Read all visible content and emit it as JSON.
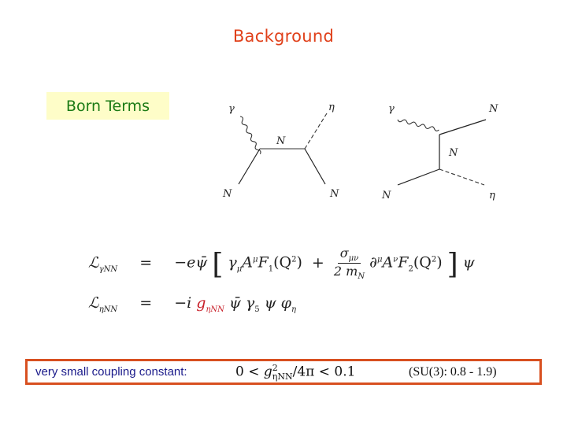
{
  "header": {
    "title": "Background"
  },
  "section": {
    "label": "Born Terms"
  },
  "diagrams": [
    {
      "name": "s-channel",
      "labels": {
        "top_left": "γ",
        "top_right": "η",
        "propagator": "N",
        "bottom_left": "N",
        "bottom_right": "N"
      }
    },
    {
      "name": "u-channel",
      "labels": {
        "top_left": "γ",
        "top_right": "N",
        "propagator": "N",
        "bottom_left": "N",
        "bottom_right": "η"
      }
    }
  ],
  "equations": {
    "gamma_nn": {
      "lhs": "ℒ",
      "lhs_sub": "γNN",
      "eq": "=",
      "pre": "−eψ̄",
      "term1": "γ",
      "term1_sub": "μ",
      "A": "A",
      "A_sup": "μ",
      "F1": "F",
      "F1_sub": "1",
      "F1_arg": "(Q",
      "F1_arg_sup": "2",
      "F1_close": ")",
      "plus": "+",
      "frac_num": "σ",
      "frac_num_sub": "μν",
      "frac_den": "2 m",
      "frac_den_sub": "N",
      "del": "∂",
      "del_sup": "μ",
      "A2": "A",
      "A2_sup": "ν",
      "F2": "F",
      "F2_sub": "2",
      "F2_arg": "(Q",
      "F2_arg_sup": "2",
      "F2_close": ")",
      "post": "ψ"
    },
    "eta_nn": {
      "lhs": "ℒ",
      "lhs_sub": "ηNN",
      "eq": "=",
      "pre": "−i",
      "coupling": "g",
      "coupling_sub": "ηNN",
      "rest": "ψ̄ γ",
      "rest_sub": "5",
      "rest2": "ψ φ",
      "rest2_sub": "η"
    }
  },
  "coupling_box": {
    "label": "very small coupling constant:",
    "inequality_left": "0 <",
    "g": "g",
    "g_sup": "2",
    "g_sub": "ηNN",
    "inequality_right": "/4π < 0.1",
    "su3_note": "(SU(3): 0.8 - 1.9)"
  },
  "colors": {
    "title": "#e0401a",
    "section_text": "#1a7a14",
    "section_bg": "#fefdc8",
    "box_border": "#d85020",
    "label_text": "#1a1a8a",
    "coupling_highlight": "#c8202a"
  }
}
